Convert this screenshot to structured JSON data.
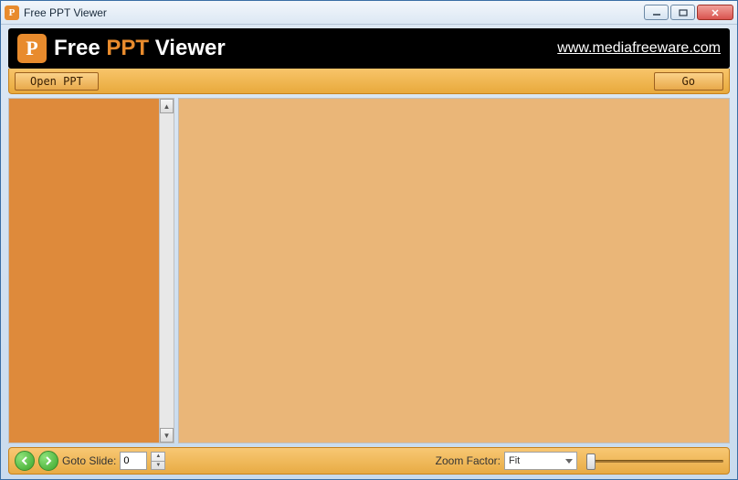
{
  "window": {
    "title": "Free PPT Viewer"
  },
  "header": {
    "title_prefix": "Free ",
    "title_accent": "PPT",
    "title_suffix": " Viewer",
    "link": "www.mediafreeware.com"
  },
  "toolbar": {
    "open_label": "Open PPT",
    "go_label": "Go"
  },
  "statusbar": {
    "goto_label": "Goto Slide:",
    "slide_value": "0",
    "zoom_label": "Zoom Factor:",
    "zoom_value": "Fit"
  }
}
